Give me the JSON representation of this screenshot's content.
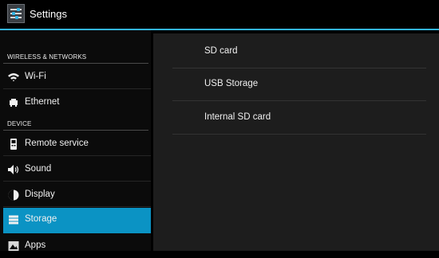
{
  "actionbar": {
    "title": "Settings",
    "accent_color": "#33b5e5",
    "icon": "settings-sliders-icon"
  },
  "sidebar": {
    "sections": [
      {
        "header": "WIRELESS & NETWORKS",
        "items": [
          {
            "label": "Wi-Fi",
            "icon": "wifi-icon"
          },
          {
            "label": "Ethernet",
            "icon": "ethernet-icon"
          }
        ]
      },
      {
        "header": "DEVICE",
        "items": [
          {
            "label": "Remote service",
            "icon": "remote-icon"
          },
          {
            "label": "Sound",
            "icon": "speaker-icon"
          },
          {
            "label": "Display",
            "icon": "display-icon"
          },
          {
            "label": "Storage",
            "icon": "storage-icon",
            "selected": true
          },
          {
            "label": "Apps",
            "icon": "apps-icon"
          }
        ]
      }
    ],
    "selected_color": "#0b93c4"
  },
  "main": {
    "storage_items": [
      {
        "label": "SD card"
      },
      {
        "label": "USB Storage"
      },
      {
        "label": "Internal SD card"
      }
    ]
  }
}
